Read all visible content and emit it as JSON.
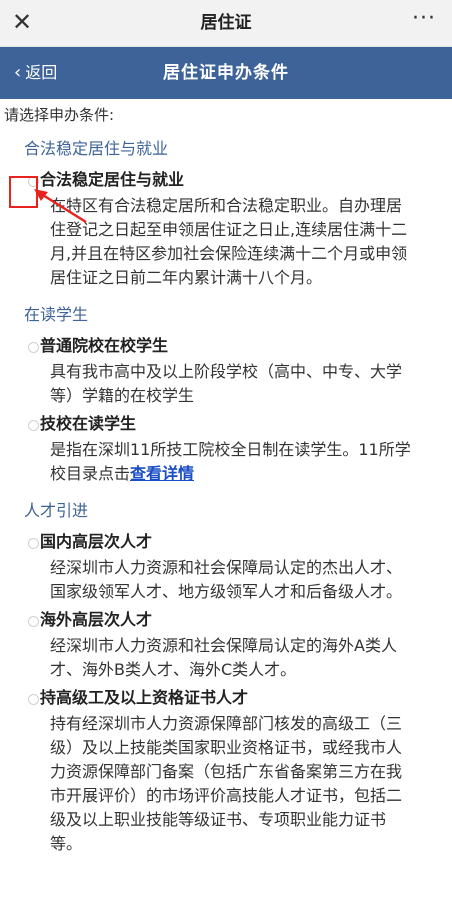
{
  "topbar": {
    "close_icon": "close-icon",
    "title": "居住证",
    "more_icon": "more-icon"
  },
  "navbar": {
    "back_label": "返回",
    "back_icon": "chevron-left-icon",
    "title": "居住证申办条件"
  },
  "prompt": "请选择申办条件:",
  "sections": [
    {
      "title": "合法稳定居住与就业",
      "items": [
        {
          "name": "合法稳定居住与就业",
          "desc": "在特区有合法稳定居所和合法稳定职业。自办理居住登记之日起至申领居住证之日止,连续居住满十二月,并且在特区参加社会保险连续满十二个月或申领居住证之日前二年内累计满十八个月。"
        }
      ]
    },
    {
      "title": "在读学生",
      "items": [
        {
          "name": "普通院校在校学生",
          "desc": "具有我市高中及以上阶段学校（高中、中专、大学等）学籍的在校学生"
        },
        {
          "name": "技校在读学生",
          "desc": "是指在深圳11所技工院校全日制在读学生。11所学校目录点击",
          "link": "查看详情"
        }
      ]
    },
    {
      "title": "人才引进",
      "items": [
        {
          "name": "国内高层次人才",
          "desc": "经深圳市人力资源和社会保障局认定的杰出人才、国家级领军人才、地方级领军人才和后备级人才。"
        },
        {
          "name": "海外高层次人才",
          "desc": "经深圳市人力资源和社会保障局认定的海外A类人才、海外B类人才、海外C类人才。"
        },
        {
          "name": "持高级工及以上资格证书人才",
          "desc": "持有经深圳市人力资源保障部门核发的高级工（三级）及以上技能类国家职业资格证书，或经我市人力资源保障部门备案（包括广东省备案第三方在我市开展评价）的市场评价高技能人才证书，包括二级及以上职业技能等级证书、专项职业能力证书等。"
        }
      ]
    }
  ],
  "colors": {
    "nav_bg": "#3e6399",
    "section_title": "#3e6399",
    "link": "#1a4ec6",
    "annotation": "#e8231e"
  }
}
